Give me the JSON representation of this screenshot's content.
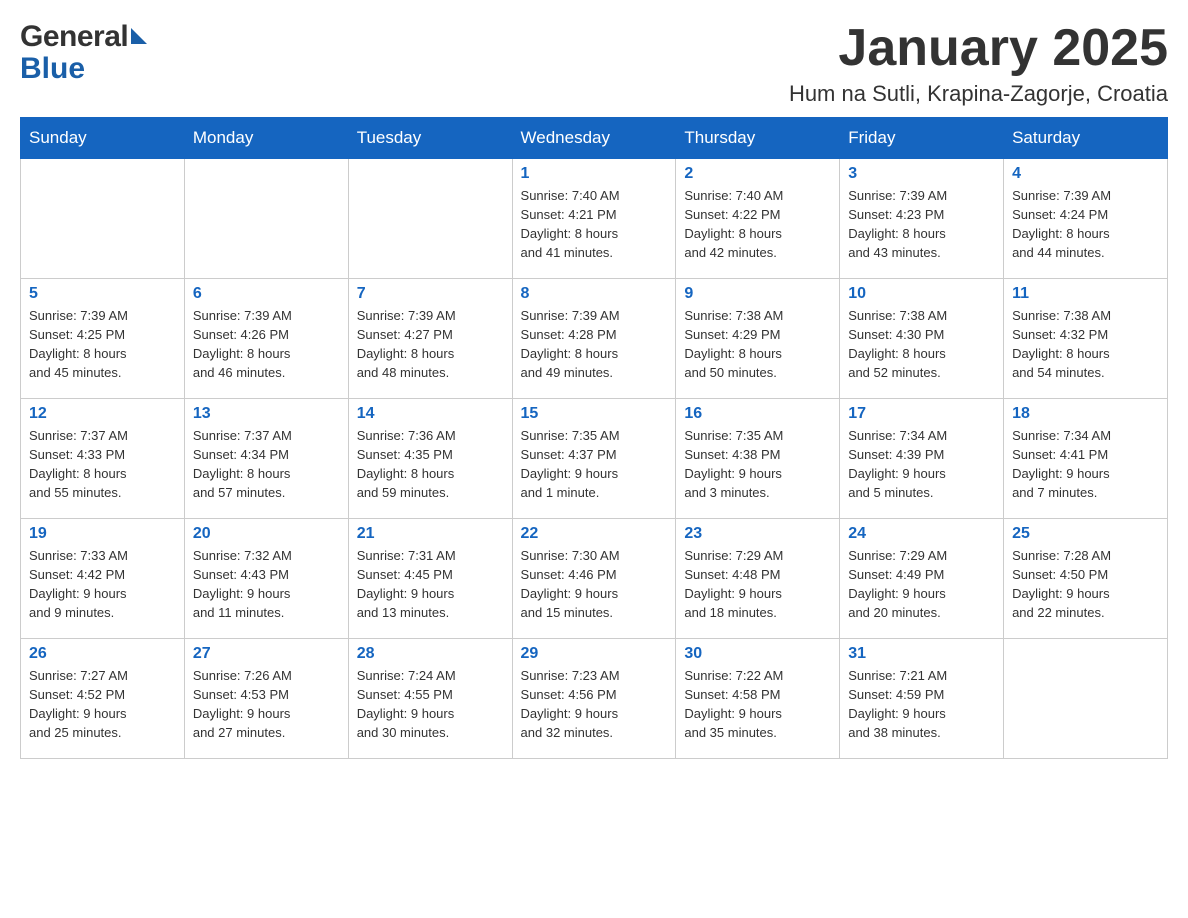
{
  "header": {
    "logo_general": "General",
    "logo_blue": "Blue",
    "month_title": "January 2025",
    "location": "Hum na Sutli, Krapina-Zagorje, Croatia"
  },
  "calendar": {
    "days_of_week": [
      "Sunday",
      "Monday",
      "Tuesday",
      "Wednesday",
      "Thursday",
      "Friday",
      "Saturday"
    ],
    "weeks": [
      [
        {
          "day": "",
          "info": ""
        },
        {
          "day": "",
          "info": ""
        },
        {
          "day": "",
          "info": ""
        },
        {
          "day": "1",
          "info": "Sunrise: 7:40 AM\nSunset: 4:21 PM\nDaylight: 8 hours\nand 41 minutes."
        },
        {
          "day": "2",
          "info": "Sunrise: 7:40 AM\nSunset: 4:22 PM\nDaylight: 8 hours\nand 42 minutes."
        },
        {
          "day": "3",
          "info": "Sunrise: 7:39 AM\nSunset: 4:23 PM\nDaylight: 8 hours\nand 43 minutes."
        },
        {
          "day": "4",
          "info": "Sunrise: 7:39 AM\nSunset: 4:24 PM\nDaylight: 8 hours\nand 44 minutes."
        }
      ],
      [
        {
          "day": "5",
          "info": "Sunrise: 7:39 AM\nSunset: 4:25 PM\nDaylight: 8 hours\nand 45 minutes."
        },
        {
          "day": "6",
          "info": "Sunrise: 7:39 AM\nSunset: 4:26 PM\nDaylight: 8 hours\nand 46 minutes."
        },
        {
          "day": "7",
          "info": "Sunrise: 7:39 AM\nSunset: 4:27 PM\nDaylight: 8 hours\nand 48 minutes."
        },
        {
          "day": "8",
          "info": "Sunrise: 7:39 AM\nSunset: 4:28 PM\nDaylight: 8 hours\nand 49 minutes."
        },
        {
          "day": "9",
          "info": "Sunrise: 7:38 AM\nSunset: 4:29 PM\nDaylight: 8 hours\nand 50 minutes."
        },
        {
          "day": "10",
          "info": "Sunrise: 7:38 AM\nSunset: 4:30 PM\nDaylight: 8 hours\nand 52 minutes."
        },
        {
          "day": "11",
          "info": "Sunrise: 7:38 AM\nSunset: 4:32 PM\nDaylight: 8 hours\nand 54 minutes."
        }
      ],
      [
        {
          "day": "12",
          "info": "Sunrise: 7:37 AM\nSunset: 4:33 PM\nDaylight: 8 hours\nand 55 minutes."
        },
        {
          "day": "13",
          "info": "Sunrise: 7:37 AM\nSunset: 4:34 PM\nDaylight: 8 hours\nand 57 minutes."
        },
        {
          "day": "14",
          "info": "Sunrise: 7:36 AM\nSunset: 4:35 PM\nDaylight: 8 hours\nand 59 minutes."
        },
        {
          "day": "15",
          "info": "Sunrise: 7:35 AM\nSunset: 4:37 PM\nDaylight: 9 hours\nand 1 minute."
        },
        {
          "day": "16",
          "info": "Sunrise: 7:35 AM\nSunset: 4:38 PM\nDaylight: 9 hours\nand 3 minutes."
        },
        {
          "day": "17",
          "info": "Sunrise: 7:34 AM\nSunset: 4:39 PM\nDaylight: 9 hours\nand 5 minutes."
        },
        {
          "day": "18",
          "info": "Sunrise: 7:34 AM\nSunset: 4:41 PM\nDaylight: 9 hours\nand 7 minutes."
        }
      ],
      [
        {
          "day": "19",
          "info": "Sunrise: 7:33 AM\nSunset: 4:42 PM\nDaylight: 9 hours\nand 9 minutes."
        },
        {
          "day": "20",
          "info": "Sunrise: 7:32 AM\nSunset: 4:43 PM\nDaylight: 9 hours\nand 11 minutes."
        },
        {
          "day": "21",
          "info": "Sunrise: 7:31 AM\nSunset: 4:45 PM\nDaylight: 9 hours\nand 13 minutes."
        },
        {
          "day": "22",
          "info": "Sunrise: 7:30 AM\nSunset: 4:46 PM\nDaylight: 9 hours\nand 15 minutes."
        },
        {
          "day": "23",
          "info": "Sunrise: 7:29 AM\nSunset: 4:48 PM\nDaylight: 9 hours\nand 18 minutes."
        },
        {
          "day": "24",
          "info": "Sunrise: 7:29 AM\nSunset: 4:49 PM\nDaylight: 9 hours\nand 20 minutes."
        },
        {
          "day": "25",
          "info": "Sunrise: 7:28 AM\nSunset: 4:50 PM\nDaylight: 9 hours\nand 22 minutes."
        }
      ],
      [
        {
          "day": "26",
          "info": "Sunrise: 7:27 AM\nSunset: 4:52 PM\nDaylight: 9 hours\nand 25 minutes."
        },
        {
          "day": "27",
          "info": "Sunrise: 7:26 AM\nSunset: 4:53 PM\nDaylight: 9 hours\nand 27 minutes."
        },
        {
          "day": "28",
          "info": "Sunrise: 7:24 AM\nSunset: 4:55 PM\nDaylight: 9 hours\nand 30 minutes."
        },
        {
          "day": "29",
          "info": "Sunrise: 7:23 AM\nSunset: 4:56 PM\nDaylight: 9 hours\nand 32 minutes."
        },
        {
          "day": "30",
          "info": "Sunrise: 7:22 AM\nSunset: 4:58 PM\nDaylight: 9 hours\nand 35 minutes."
        },
        {
          "day": "31",
          "info": "Sunrise: 7:21 AM\nSunset: 4:59 PM\nDaylight: 9 hours\nand 38 minutes."
        },
        {
          "day": "",
          "info": ""
        }
      ]
    ]
  }
}
